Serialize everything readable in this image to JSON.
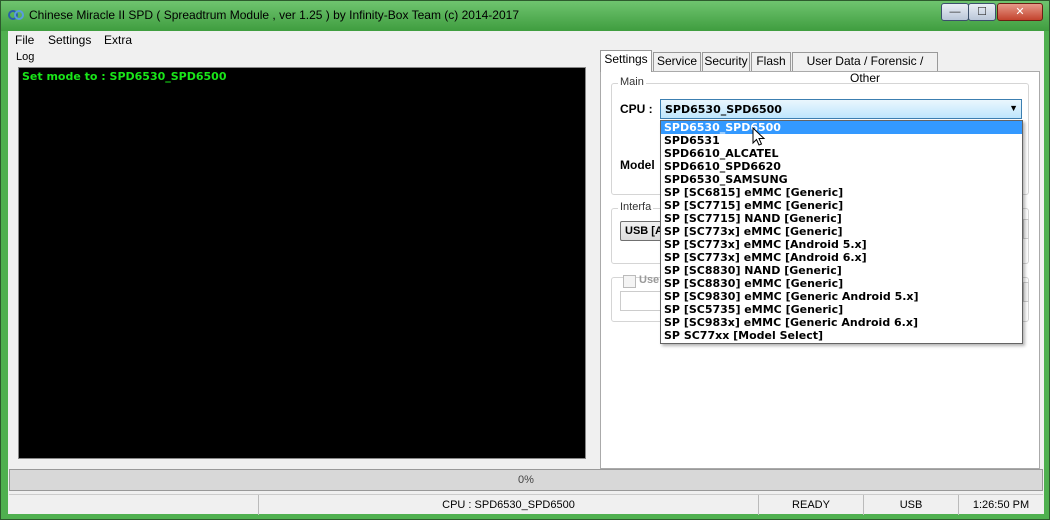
{
  "window": {
    "title": "Chinese Miracle II SPD ( Spreadtrum Module , ver 1.25 ) by Infinity-Box Team (c) 2014-2017",
    "min_glyph": "—",
    "max_glyph": "☐",
    "close_glyph": "✕"
  },
  "menu": [
    "File",
    "Settings",
    "Extra"
  ],
  "log": {
    "label": "Log",
    "lines": [
      "Set mode to : SPD6530_SPD6500"
    ]
  },
  "tabs": [
    "Settings",
    "Service",
    "Security",
    "Flash",
    "User Data / Forensic / Other"
  ],
  "settings": {
    "main_group": "Main",
    "cpu_label": "CPU :",
    "cpu_selected": "SPD6530_SPD6500",
    "model_label": "Model",
    "interface_group": "Interfa",
    "usb_button": "USB [A",
    "use_checkbox_label": "Use"
  },
  "cpu_options": [
    "SPD6530_SPD6500",
    "SPD6531",
    "SPD6610_ALCATEL",
    "SPD6610_SPD6620",
    "SPD6530_SAMSUNG",
    "SP [SC6815] eMMC [Generic]",
    "SP [SC7715] eMMC [Generic]",
    "SP [SC7715] NAND [Generic]",
    "SP [SC773x] eMMC [Generic]",
    "SP [SC773x] eMMC [Android 5.x]",
    "SP [SC773x] eMMC [Android 6.x]",
    "SP [SC8830] NAND [Generic]",
    "SP [SC8830] eMMC [Generic]",
    "SP [SC9830] eMMC [Generic Android 5.x]",
    "SP [SC5735] eMMC [Generic]",
    "SP [SC983x] eMMC [Generic Android 6.x]",
    "SP SC77xx [Model Select]"
  ],
  "progress": {
    "text": "0%",
    "value": 0
  },
  "status": {
    "cpu": "CPU : SPD6530_SPD6500",
    "state": "READY",
    "interface": "USB",
    "time": "1:26:50 PM"
  },
  "colors": {
    "log_text": "#19e619",
    "selection": "#3399ff"
  }
}
